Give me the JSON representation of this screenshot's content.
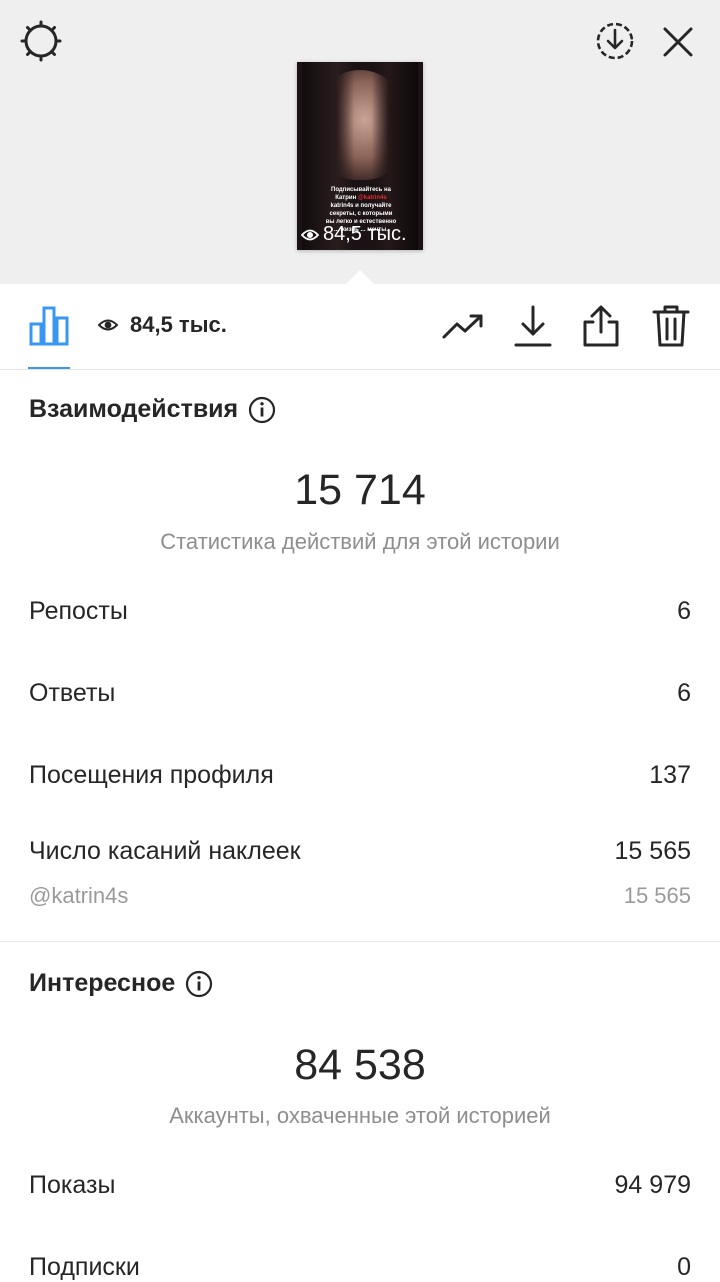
{
  "story": {
    "caption_parts": [
      "Подписывайтесь на Катрин ",
      "@katrin4s",
      " katrin4s и получайте секреты, с которыми вы легко и естественно ... жизнь ... мечты."
    ],
    "views_overlay": "84,5 тыс."
  },
  "toolbar": {
    "views": "84,5 тыс."
  },
  "interactions": {
    "title": "Взаимодействия",
    "total": "15 714",
    "subtitle": "Статистика действий для этой истории",
    "rows": [
      {
        "label": "Репосты",
        "value": "6"
      },
      {
        "label": "Ответы",
        "value": "6"
      },
      {
        "label": "Посещения профиля",
        "value": "137"
      },
      {
        "label": "Число касаний наклеек",
        "value": "15 565"
      }
    ],
    "sticker": {
      "label": "@katrin4s",
      "value": "15 565"
    }
  },
  "discovery": {
    "title": "Интересное",
    "total": "84 538",
    "subtitle": "Аккаунты, охваченные этой историей",
    "rows": [
      {
        "label": "Показы",
        "value": "94 979"
      },
      {
        "label": "Подписки",
        "value": "0"
      }
    ]
  },
  "colors": {
    "accent": "#3897f0",
    "text": "#262626",
    "secondary": "#8e8e8e",
    "top_background": "#efefef"
  }
}
